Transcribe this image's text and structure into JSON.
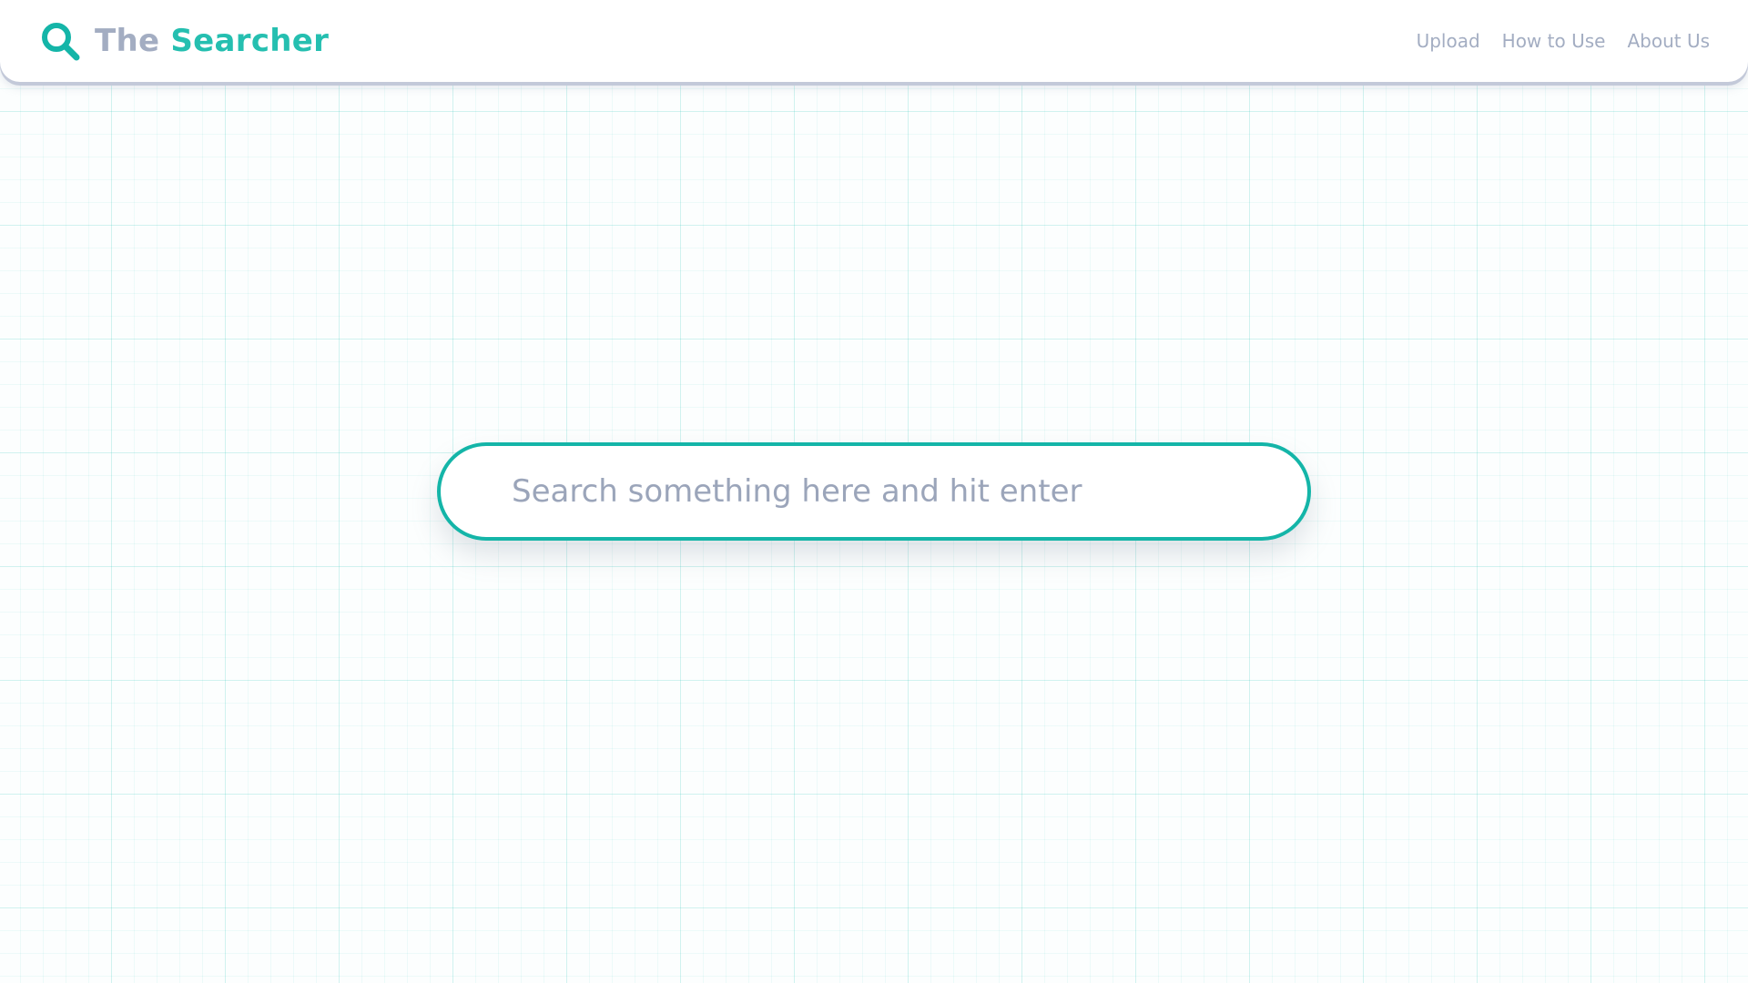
{
  "header": {
    "brand": {
      "icon": "magnifier-icon",
      "word_the": "The",
      "word_searcher": "Searcher"
    },
    "nav": [
      {
        "label": "Upload"
      },
      {
        "label": "How to Use"
      },
      {
        "label": "About Us"
      }
    ]
  },
  "search": {
    "placeholder": "Search something here and hit enter",
    "value": ""
  },
  "colors": {
    "accent": "#14b5a8",
    "brand_gray": "#a3adc2",
    "nav_text": "#a3adc2",
    "placeholder": "#9ba5ba",
    "grid": "#c7eeea"
  }
}
